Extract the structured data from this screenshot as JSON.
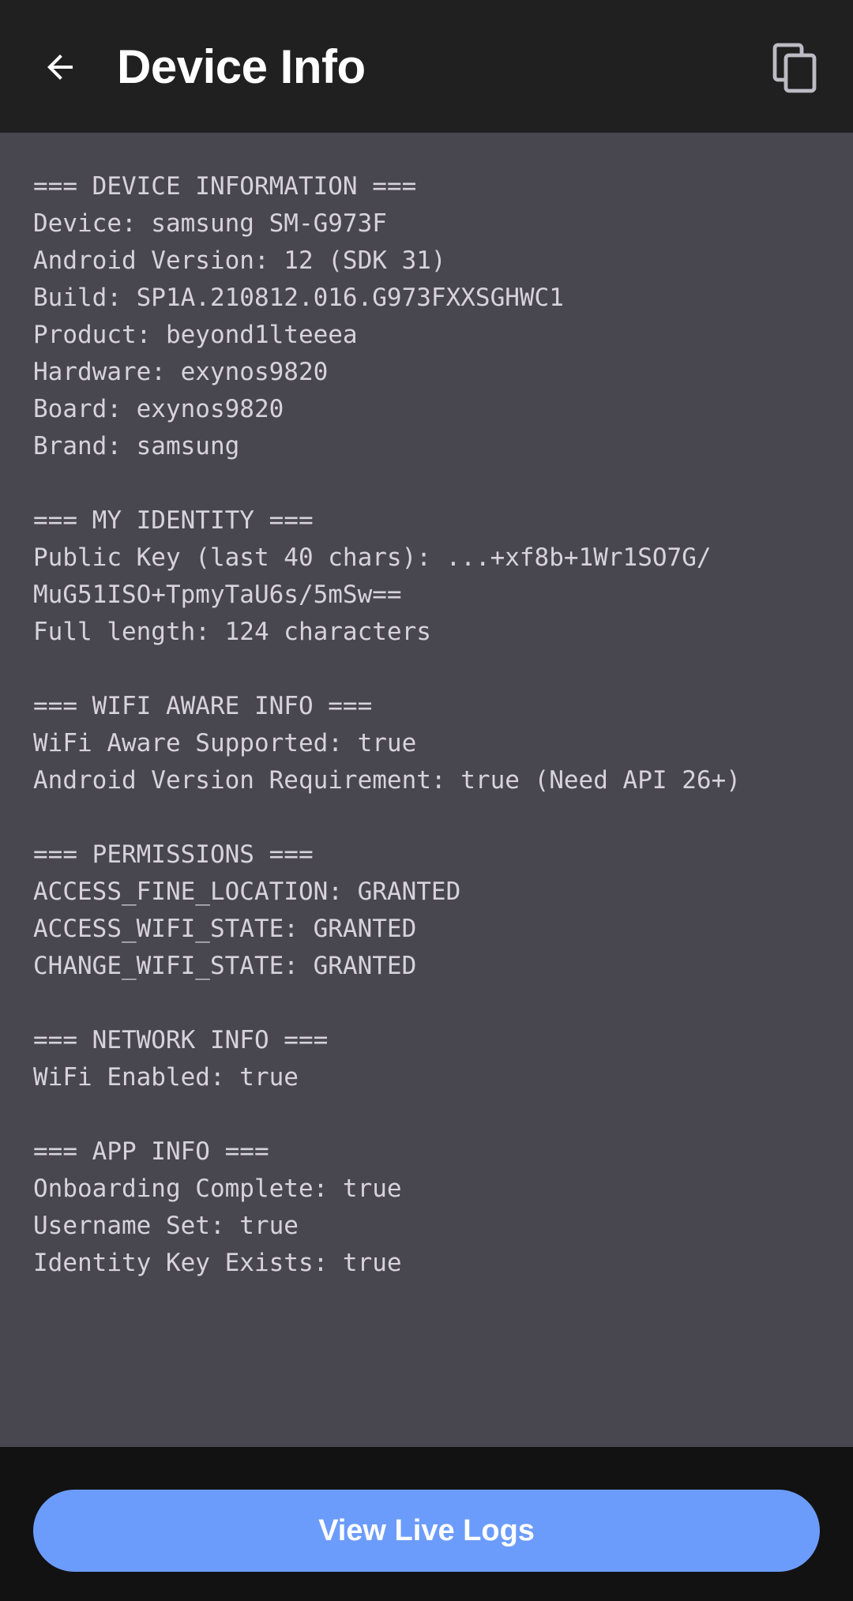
{
  "colors": {
    "topbar": "#202020",
    "content_bg": "#48464f",
    "text": "#d6d3dc",
    "accent": "#6c9cfb"
  },
  "header": {
    "title": "Device Info",
    "back_icon": "arrow-back-icon",
    "copy_icon": "copy-icon"
  },
  "info_text": "=== DEVICE INFORMATION ===\nDevice: samsung SM-G973F\nAndroid Version: 12 (SDK 31)\nBuild: SP1A.210812.016.G973FXXSGHWC1\nProduct: beyond1lteeea\nHardware: exynos9820\nBoard: exynos9820\nBrand: samsung\n\n=== MY IDENTITY ===\nPublic Key (last 40 chars): ...+xf8b+1Wr1SO7G/\nMuG51ISO+TpmyTaU6s/5mSw==\nFull length: 124 characters\n\n=== WIFI AWARE INFO ===\nWiFi Aware Supported: true\nAndroid Version Requirement: true (Need API 26+)\n\n=== PERMISSIONS ===\nACCESS_FINE_LOCATION: GRANTED\nACCESS_WIFI_STATE: GRANTED\nCHANGE_WIFI_STATE: GRANTED\n\n=== NETWORK INFO ===\nWiFi Enabled: true\n\n=== APP INFO ===\nOnboarding Complete: true\nUsername Set: true\nIdentity Key Exists: true",
  "footer": {
    "button_label": "View Live Logs"
  }
}
